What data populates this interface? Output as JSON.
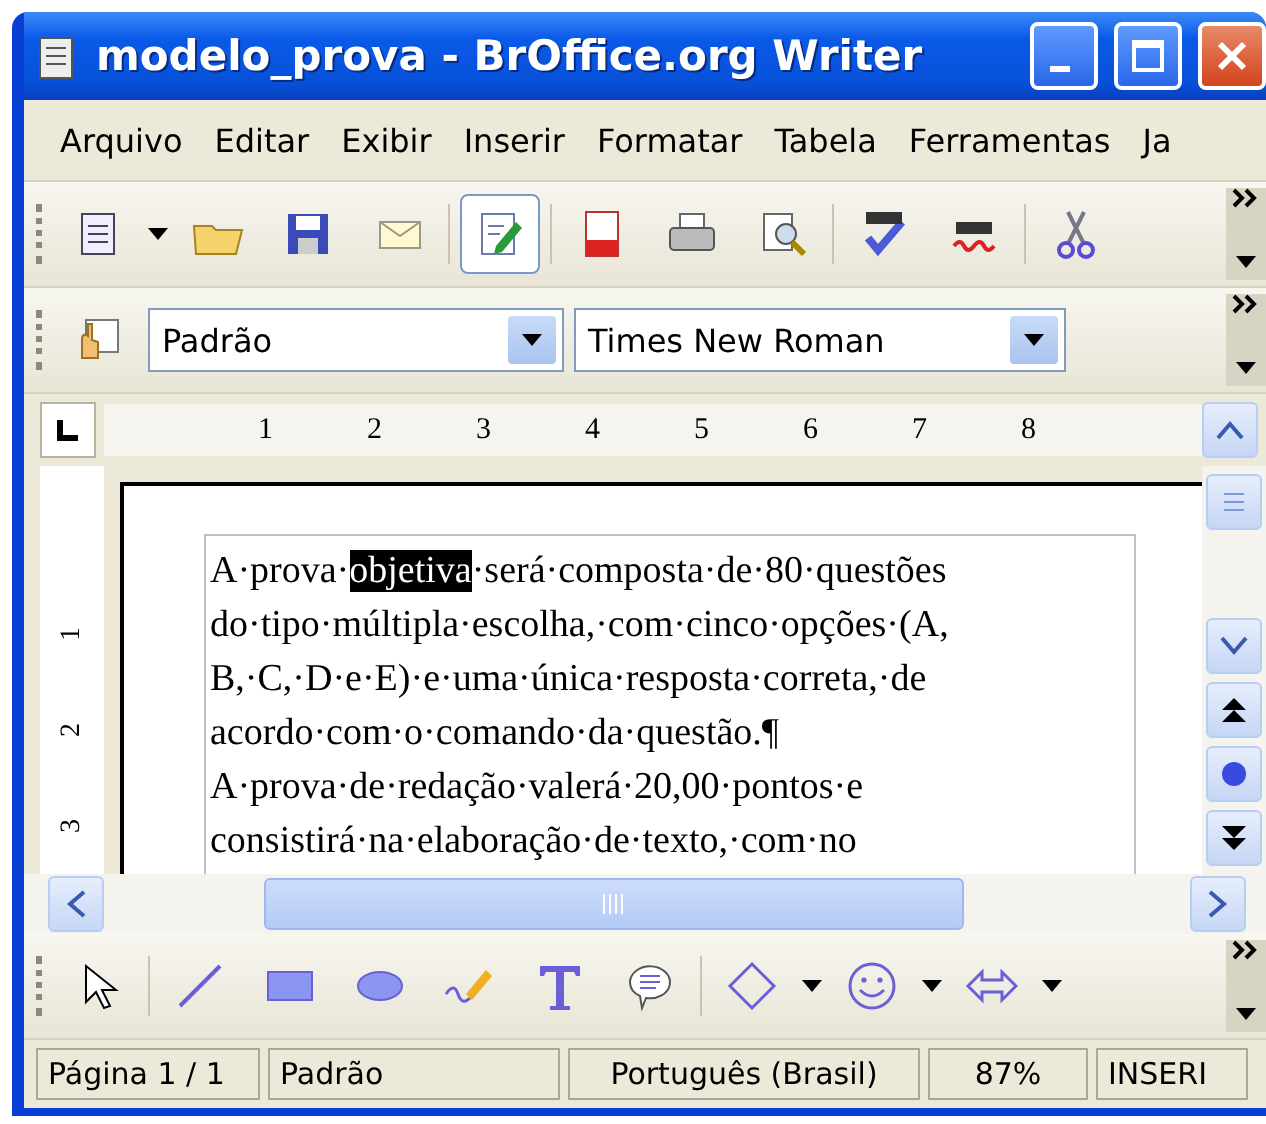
{
  "window": {
    "title": "modelo_prova - BrOffice.org Writer"
  },
  "menu": [
    {
      "label": "Arquivo"
    },
    {
      "label": "Editar"
    },
    {
      "label": "Exibir"
    },
    {
      "label": "Inserir"
    },
    {
      "label": "Formatar"
    },
    {
      "label": "Tabela"
    },
    {
      "label": "Ferramentas"
    },
    {
      "label": "Ja"
    }
  ],
  "standard_toolbar": {
    "edit_mode_pressed": true
  },
  "formatting_toolbar": {
    "style": "Padrão",
    "font": "Times New Roman"
  },
  "ruler": {
    "marks": [
      "1",
      "2",
      "3",
      "4",
      "5",
      "6",
      "7",
      "8"
    ]
  },
  "vertical_ruler": {
    "marks": [
      "1",
      "2",
      "3"
    ]
  },
  "document": {
    "lines": [
      [
        {
          "text": "A·prova·",
          "selected": false
        },
        {
          "text": "objetiva",
          "selected": true
        },
        {
          "text": "·será·composta·de·80·questões",
          "selected": false
        }
      ],
      [
        {
          "text": "do·tipo·múltipla·escolha,·com·cinco·opções·(A,",
          "selected": false
        }
      ],
      [
        {
          "text": "B,·C,·D·e·E)·e·uma·única·resposta·correta,·de",
          "selected": false
        }
      ],
      [
        {
          "text": "acordo·com·o·comando·da·questão.¶",
          "selected": false
        }
      ],
      [
        {
          "text": "A·prova·de·redação·valerá·20,00·pontos·e",
          "selected": false
        }
      ],
      [
        {
          "text": "consistirá·na·elaboração·de·texto,·com·no",
          "selected": false
        }
      ]
    ]
  },
  "status_bar": [
    "Página 1 / 1",
    "Padrão",
    "Português (Brasil)",
    "87%",
    "INSERI"
  ]
}
